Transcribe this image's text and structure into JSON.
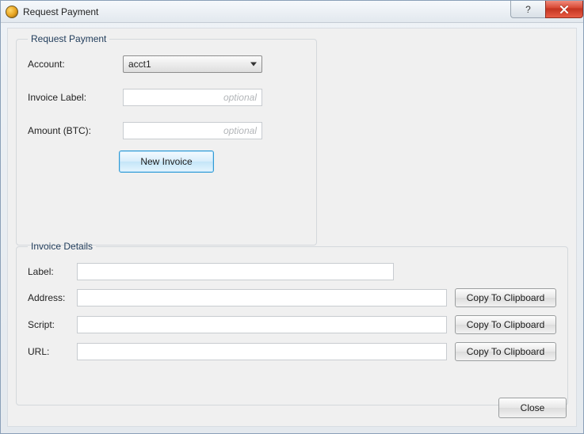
{
  "window": {
    "title": "Request Payment"
  },
  "request": {
    "legend": "Request Payment",
    "account_label": "Account:",
    "account_selected": "acct1",
    "invoice_label_label": "Invoice Label:",
    "invoice_label_value": "",
    "invoice_label_placeholder": "optional",
    "amount_label": "Amount (BTC):",
    "amount_value": "",
    "amount_placeholder": "optional",
    "new_invoice_button": "New Invoice"
  },
  "details": {
    "legend": "Invoice Details",
    "label_label": "Label:",
    "label_value": "",
    "address_label": "Address:",
    "address_value": "",
    "script_label": "Script:",
    "script_value": "",
    "url_label": "URL:",
    "url_value": "",
    "copy_button": "Copy To Clipboard"
  },
  "footer": {
    "close_button": "Close"
  },
  "titlebar": {
    "help_glyph": "?"
  }
}
